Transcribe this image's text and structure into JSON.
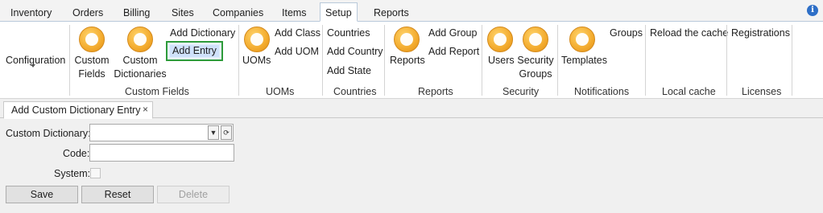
{
  "menubar": {
    "tabs": [
      "Inventory",
      "Orders",
      "Billing",
      "Sites",
      "Companies",
      "Items",
      "Setup",
      "Reports"
    ],
    "active_tab": "Setup",
    "info_icon": "info-icon"
  },
  "ribbon": {
    "configuration": {
      "label": "Configuration"
    },
    "custom_fields": {
      "group_label": "Custom Fields",
      "custom_fields_line1": "Custom",
      "custom_fields_line2": "Fields",
      "custom_dictionaries_line1": "Custom",
      "custom_dictionaries_line2": "Dictionaries",
      "add_dictionary": "Add Dictionary",
      "add_entry": "Add Entry"
    },
    "uoms": {
      "group_label": "UOMs",
      "uoms_label": "UOMs",
      "add_class": "Add Class",
      "add_uom": "Add UOM"
    },
    "countries": {
      "group_label": "Countries",
      "countries_label": "Countries",
      "add_country": "Add Country",
      "add_state": "Add State"
    },
    "reports": {
      "group_label": "Reports",
      "reports_label": "Reports",
      "add_group": "Add Group",
      "add_report": "Add Report"
    },
    "security": {
      "group_label": "Security",
      "users": "Users",
      "security_groups_line1": "Security",
      "security_groups_line2": "Groups"
    },
    "notifications": {
      "group_label": "Notifications",
      "templates": "Templates",
      "groups": "Groups"
    },
    "local_cache": {
      "group_label": "Local cache",
      "reload": "Reload the cache"
    },
    "licenses": {
      "group_label": "Licenses",
      "registrations": "Registrations"
    },
    "accent_color": "#2e9b3a",
    "icon_color": "#f3ab2e"
  },
  "document_tab": {
    "label": "Add Custom Dictionary Entry",
    "close": "×"
  },
  "form": {
    "custom_dictionary_label": "Custom Dictionary:",
    "custom_dictionary_value": "",
    "code_label": "Code:",
    "code_value": "",
    "system_label": "System:",
    "system_checked": false,
    "save": "Save",
    "reset": "Reset",
    "delete": "Delete"
  }
}
